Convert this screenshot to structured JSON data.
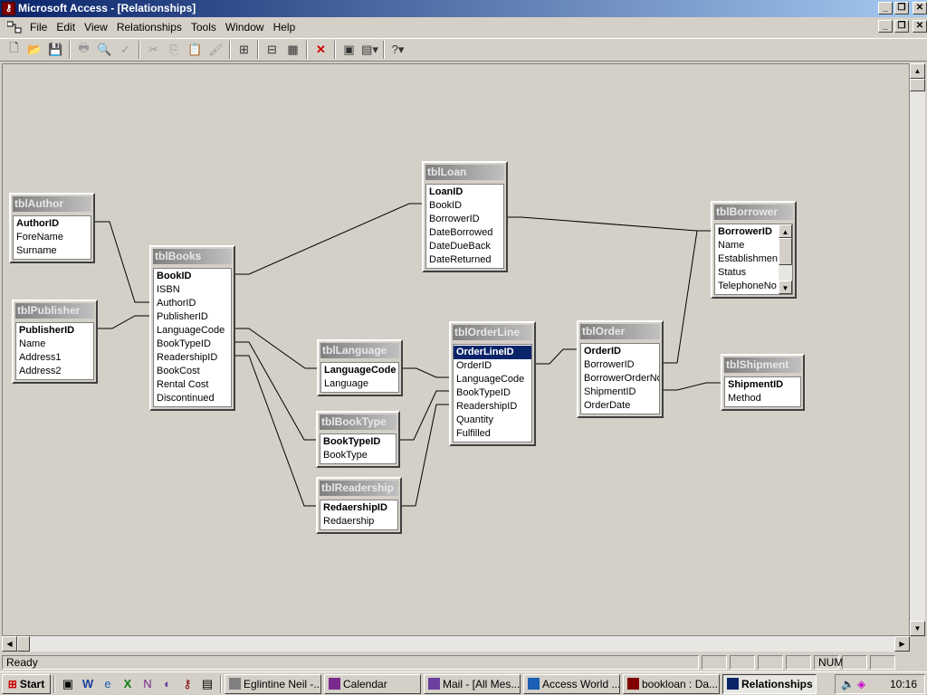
{
  "window": {
    "title": "Microsoft Access - [Relationships]"
  },
  "menu": [
    "File",
    "Edit",
    "View",
    "Relationships",
    "Tools",
    "Window",
    "Help"
  ],
  "toolbar": [
    "new-icon",
    "open-icon",
    "save-icon",
    "print-icon",
    "print-preview-icon",
    "spelling-icon",
    "cut-icon",
    "copy-icon",
    "paste-icon",
    "format-painter-icon",
    "show-table-icon",
    "show-direct-icon",
    "show-all-icon",
    "delete-icon",
    "database-window-icon",
    "new-object-icon",
    "help-icon"
  ],
  "tables": {
    "tblAuthor": {
      "name": "tblAuthor",
      "fields": [
        "AuthorID",
        "ForeName",
        "Surname"
      ],
      "pk": 0
    },
    "tblPublisher": {
      "name": "tblPublisher",
      "fields": [
        "PublisherID",
        "Name",
        "Address1",
        "Address2"
      ],
      "pk": 0
    },
    "tblBooks": {
      "name": "tblBooks",
      "fields": [
        "BookID",
        "ISBN",
        "AuthorID",
        "PublisherID",
        "LanguageCode",
        "BookTypeID",
        "ReadershipID",
        "BookCost",
        "Rental Cost",
        "Discontinued"
      ],
      "pk": 0
    },
    "tblLoan": {
      "name": "tblLoan",
      "fields": [
        "LoanID",
        "BookID",
        "BorrowerID",
        "DateBorrowed",
        "DateDueBack",
        "DateReturned"
      ],
      "pk": 0
    },
    "tblLanguage": {
      "name": "tblLanguage",
      "fields": [
        "LanguageCode",
        "Language"
      ],
      "pk": 0
    },
    "tblBookType": {
      "name": "tblBookType",
      "fields": [
        "BookTypeID",
        "BookType"
      ],
      "pk": 0
    },
    "tblReadership": {
      "name": "tblReadership",
      "fields": [
        "RedaershipID",
        "Redaership"
      ],
      "pk": 0
    },
    "tblOrderLine": {
      "name": "tblOrderLine",
      "fields": [
        "OrderLineID",
        "OrderID",
        "LanguageCode",
        "BookTypeID",
        "ReadershipID",
        "Quantity",
        "Fulfilled"
      ],
      "pk": 0
    },
    "tblOrder": {
      "name": "tblOrder",
      "fields": [
        "OrderID",
        "BorrowerID",
        "BorrowerOrderNo",
        "ShipmentID",
        "OrderDate"
      ],
      "pk": 0
    },
    "tblBorrower": {
      "name": "tblBorrower",
      "fields": [
        "BorrowerID",
        "Name",
        "Establishment",
        "Status",
        "TelephoneNo"
      ],
      "pk": 0
    },
    "tblShipment": {
      "name": "tblShipment",
      "fields": [
        "ShipmentID",
        "Method"
      ],
      "pk": 0
    }
  },
  "status": {
    "text": "Ready",
    "num": "NUM"
  },
  "taskbar": {
    "start": "Start",
    "tasks": [
      "Eglintine Neil -...",
      "Calendar",
      "Mail - [All Mes...",
      "Access World ...",
      "bookloan : Da...",
      "Relationships"
    ],
    "active": "Relationships",
    "clock": "10:16"
  }
}
